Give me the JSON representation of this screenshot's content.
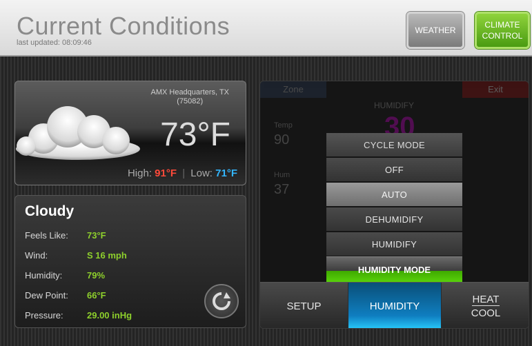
{
  "header": {
    "title": "Current Conditions",
    "last_updated": "last updated: 08:09:46",
    "buttons": {
      "weather": "WEATHER",
      "climate_line1": "CLIMATE",
      "climate_line2": "CONTROL"
    }
  },
  "weather": {
    "location_line1": "AMX Headquarters, TX",
    "location_line2": "(75082)",
    "temperature": "73°F",
    "high_label": "High:",
    "high_value": "91°F",
    "low_label": "Low:",
    "low_value": "71°F",
    "icon": "cloud-icon"
  },
  "conditions": {
    "summary": "Cloudy",
    "rows": [
      {
        "label": "Feels Like:",
        "value": "73°F"
      },
      {
        "label": "Wind:",
        "value": "S 16 mph"
      },
      {
        "label": "Humidity:",
        "value": "79%"
      },
      {
        "label": "Dew Point:",
        "value": "66°F"
      },
      {
        "label": "Pressure:",
        "value": "29.00 inHg"
      }
    ],
    "refresh_icon": "refresh-icon"
  },
  "climate": {
    "background": {
      "zone": "Zone",
      "exit": "Exit",
      "temp_label": "Temp",
      "temp_value": "90",
      "hum_label": "Hum",
      "hum_value": "37",
      "humidify_label": "HUMIDIFY",
      "setpoint": "30"
    },
    "menu": {
      "header": "CYCLE MODE",
      "items": [
        "OFF",
        "AUTO",
        "DEHUMIDIFY",
        "HUMIDIFY"
      ],
      "selected": "AUTO"
    },
    "humidity_mode": "HUMIDITY MODE",
    "tabs": {
      "setup": "SETUP",
      "humidity": "HUMIDITY",
      "heat": "HEAT",
      "cool": "COOL"
    }
  },
  "colors": {
    "accent_green": "#58d10a",
    "accent_blue": "#0f7ec0",
    "high_red": "#ff4a3a",
    "low_blue": "#33b6ff"
  }
}
